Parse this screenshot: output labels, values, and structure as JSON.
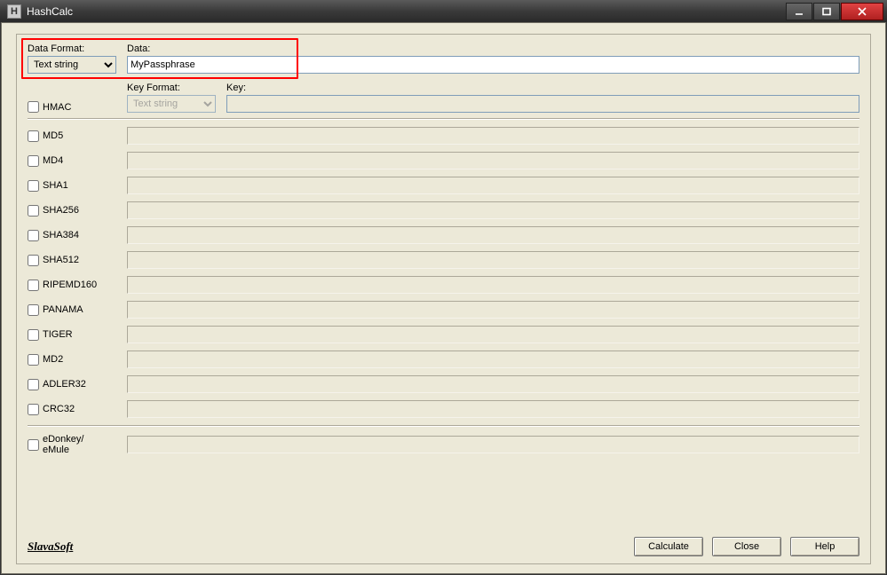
{
  "window": {
    "title": "HashCalc"
  },
  "labels": {
    "data_format": "Data Format:",
    "data": "Data:",
    "key_format": "Key Format:",
    "key": "Key:"
  },
  "data_format_selected": "Text string",
  "data_value": "MyPassphrase",
  "hmac": {
    "label": "HMAC",
    "checked": false,
    "key_format_selected": "Text string",
    "key_value": ""
  },
  "hashes": [
    {
      "name": "MD5",
      "checked": false,
      "value": ""
    },
    {
      "name": "MD4",
      "checked": false,
      "value": ""
    },
    {
      "name": "SHA1",
      "checked": false,
      "value": ""
    },
    {
      "name": "SHA256",
      "checked": false,
      "value": ""
    },
    {
      "name": "SHA384",
      "checked": false,
      "value": ""
    },
    {
      "name": "SHA512",
      "checked": false,
      "value": ""
    },
    {
      "name": "RIPEMD160",
      "checked": false,
      "value": ""
    },
    {
      "name": "PANAMA",
      "checked": false,
      "value": ""
    },
    {
      "name": "TIGER",
      "checked": false,
      "value": ""
    },
    {
      "name": "MD2",
      "checked": false,
      "value": ""
    },
    {
      "name": "ADLER32",
      "checked": false,
      "value": ""
    },
    {
      "name": "CRC32",
      "checked": false,
      "value": ""
    }
  ],
  "edonkey": {
    "label": "eDonkey/\neMule",
    "checked": false,
    "value": ""
  },
  "brand": "SlavaSoft",
  "buttons": {
    "calculate": "Calculate",
    "close": "Close",
    "help": "Help"
  }
}
